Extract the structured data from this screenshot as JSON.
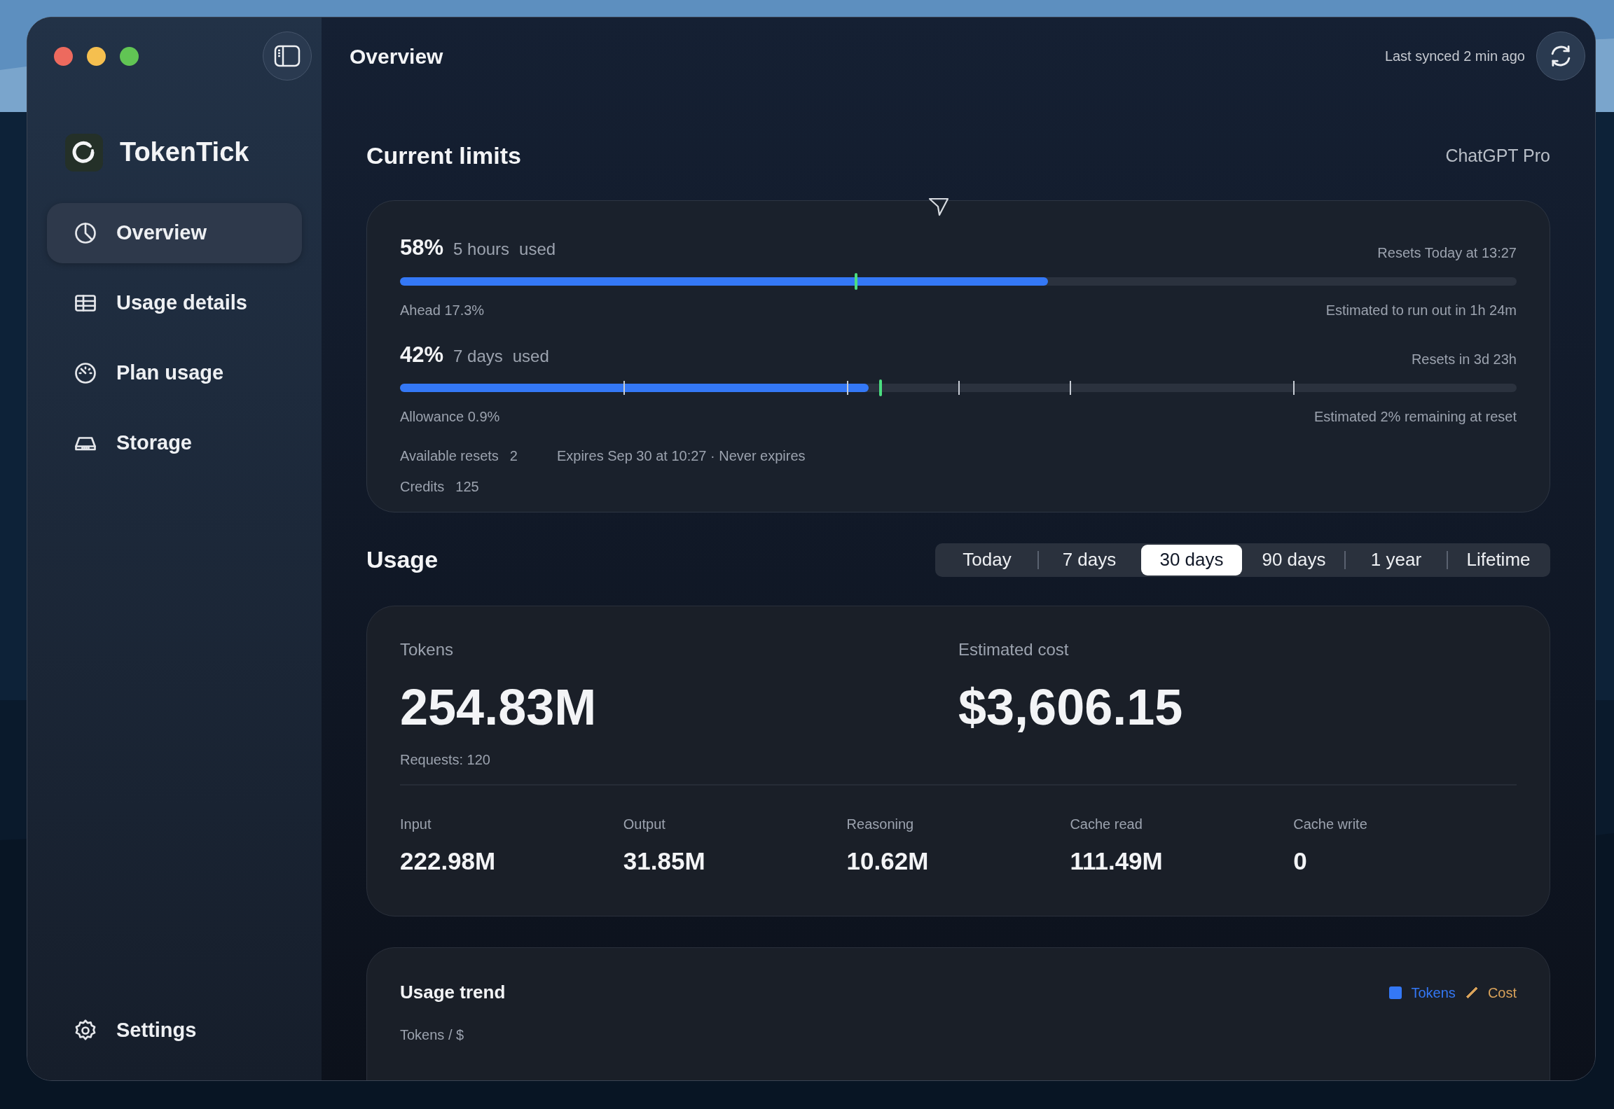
{
  "window": {
    "title": "Overview"
  },
  "sync": {
    "text": "Last synced 2 min ago"
  },
  "sidebar": {
    "app_name": "TokenTick",
    "items": [
      {
        "label": "Overview",
        "selected": true
      },
      {
        "label": "Usage details",
        "selected": false
      },
      {
        "label": "Plan usage",
        "selected": false
      },
      {
        "label": "Storage",
        "selected": false
      }
    ],
    "footer_item": {
      "label": "Settings",
      "selected": false
    }
  },
  "limits": {
    "title": "Current limits",
    "plan": "ChatGPT Pro",
    "meters": [
      {
        "percent": "58%",
        "period": "5 hours",
        "suffix": "used",
        "resets": "Resets Today at 13:27",
        "level": 0.58,
        "marker": {
          "level": 0.407
        },
        "note_left": "Ahead 17.3%",
        "note_right": "Estimated to run out in 1h 24m"
      },
      {
        "percent": "42%",
        "period": "7 days",
        "suffix": "used",
        "resets": "Resets in 3d 23h",
        "level": 0.42,
        "marker": {
          "level": 0.429
        },
        "ticks": [
          {
            "level": 0.2
          },
          {
            "level": 0.4
          },
          {
            "level": 0.5
          },
          {
            "level": 0.6
          },
          {
            "level": 0.8
          }
        ],
        "note_left": "Allowance 0.9%",
        "note_right": "Estimated 2% remaining at reset"
      }
    ],
    "details": [
      {
        "label": "Available resets",
        "value": "2",
        "note": "Expires Sep 30 at 10:27 · Never expires"
      },
      {
        "label": "Credits",
        "value": "125"
      }
    ]
  },
  "usage": {
    "title": "Usage",
    "ranges": [
      {
        "label": "Today",
        "selected": false
      },
      {
        "label": "7 days",
        "selected": false
      },
      {
        "label": "30 days",
        "selected": true
      },
      {
        "label": "90 days",
        "selected": false
      },
      {
        "label": "1 year",
        "selected": false
      },
      {
        "label": "Lifetime",
        "selected": false
      }
    ],
    "summary": [
      {
        "label": "Tokens",
        "value": "254.83M",
        "sub": "Requests: 120"
      },
      {
        "label": "Estimated cost",
        "value": "$3,606.15"
      }
    ],
    "breakdown": [
      {
        "label": "Input",
        "value": "222.98M"
      },
      {
        "label": "Output",
        "value": "31.85M"
      },
      {
        "label": "Reasoning",
        "value": "10.62M"
      },
      {
        "label": "Cache read",
        "value": "111.49M"
      },
      {
        "label": "Cache write",
        "value": "0"
      }
    ]
  },
  "trend": {
    "title": "Usage trend",
    "legend": [
      {
        "label": "Tokens",
        "color": "#3478f6",
        "kind": "square"
      },
      {
        "label": "Cost",
        "color": "#d9a25a",
        "kind": "line"
      }
    ],
    "axis_label": "Tokens / $"
  }
}
